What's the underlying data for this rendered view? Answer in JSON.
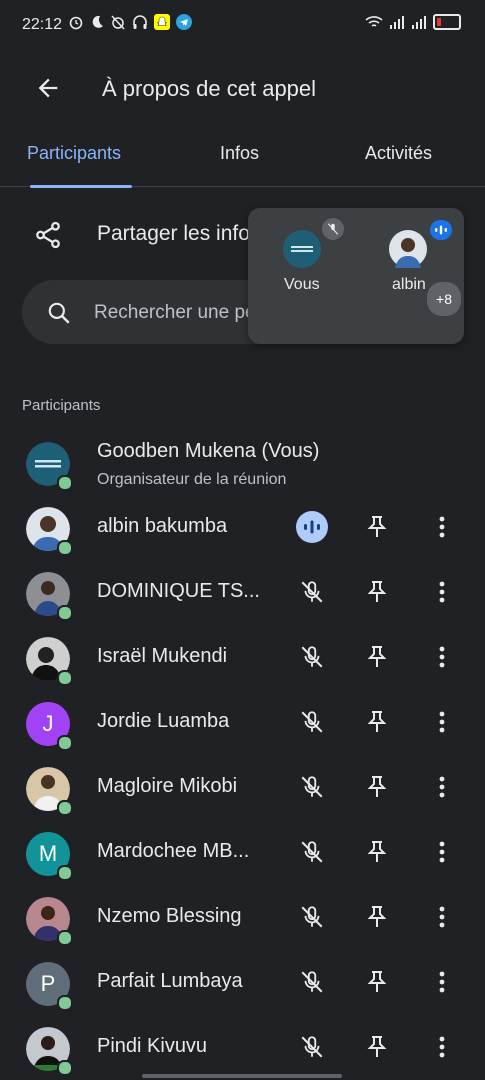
{
  "status": {
    "time": "22:12"
  },
  "header": {
    "title": "À propos de cet appel",
    "back_icon": "arrow-back-icon"
  },
  "tabs": [
    {
      "label": "Participants",
      "active": true
    },
    {
      "label": "Infos",
      "active": false
    },
    {
      "label": "Activités",
      "active": false
    }
  ],
  "share": {
    "label": "Partager les informations"
  },
  "search": {
    "placeholder": "Rechercher une personne participant..."
  },
  "pip": {
    "you_label": "Vous",
    "albin_label": "albin",
    "more_count": "+8"
  },
  "section": {
    "label": "Participants"
  },
  "participants": [
    {
      "name": "Goodben Mukena (Vous)",
      "subtitle": "Organisateur de la réunion",
      "avatar_type": "logo",
      "color": "#1f5f75"
    },
    {
      "name": "albin bakumba",
      "avatar_type": "photo",
      "color": "#6c7ea0",
      "speaking": true
    },
    {
      "name": "DOMINIQUE TS...",
      "avatar_type": "photo",
      "color": "#3a4a6b"
    },
    {
      "name": "Israël Mukendi",
      "avatar_type": "photo",
      "color": "#444"
    },
    {
      "name": "Jordie Luamba",
      "avatar_type": "letter",
      "letter": "J",
      "color": "#a142f4"
    },
    {
      "name": "Magloire Mikobi",
      "avatar_type": "photo",
      "color": "#8a6b52"
    },
    {
      "name": "Mardochee MB...",
      "avatar_type": "letter",
      "letter": "M",
      "color": "#12939a"
    },
    {
      "name": "Nzemo Blessing",
      "avatar_type": "photo",
      "color": "#9b6b7a"
    },
    {
      "name": "Parfait Lumbaya",
      "avatar_type": "letter",
      "letter": "P",
      "color": "#5f6e78"
    },
    {
      "name": "Pindi Kivuvu",
      "avatar_type": "photo",
      "color": "#c4c9cf"
    }
  ]
}
